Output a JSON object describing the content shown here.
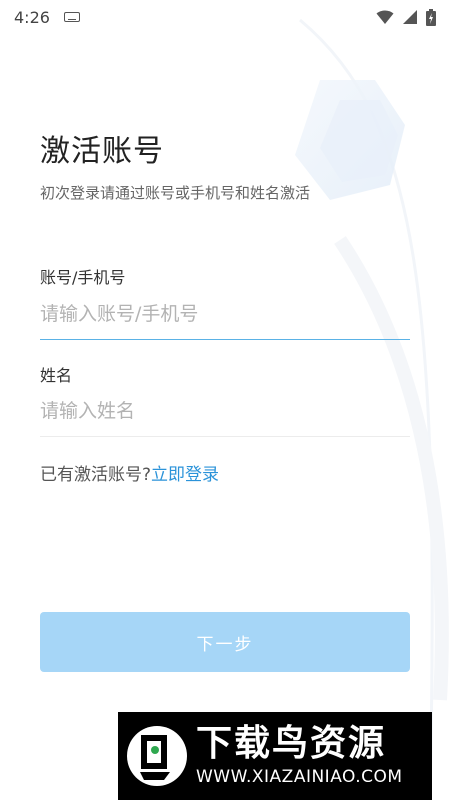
{
  "status_bar": {
    "time": "4:26",
    "icons": [
      "keyboard-icon",
      "wifi-icon",
      "signal-icon",
      "battery-icon"
    ]
  },
  "header": {
    "title": "激活账号",
    "subtitle": "初次登录请通过账号或手机号和姓名激活"
  },
  "form": {
    "account": {
      "label": "账号/手机号",
      "placeholder": "请输入账号/手机号",
      "value": ""
    },
    "name": {
      "label": "姓名",
      "placeholder": "请输入姓名",
      "value": ""
    }
  },
  "login_hint": {
    "text": "已有激活账号?",
    "link": "立即登录"
  },
  "next_button": {
    "label": "下一步"
  },
  "watermark": {
    "text_cn": "下载鸟资源",
    "url": "WWW.XIAZAINIAO.COM"
  },
  "colors": {
    "accent": "#2b93d9",
    "button_disabled": "#a6d6f7",
    "active_line": "#5ab2e6"
  }
}
